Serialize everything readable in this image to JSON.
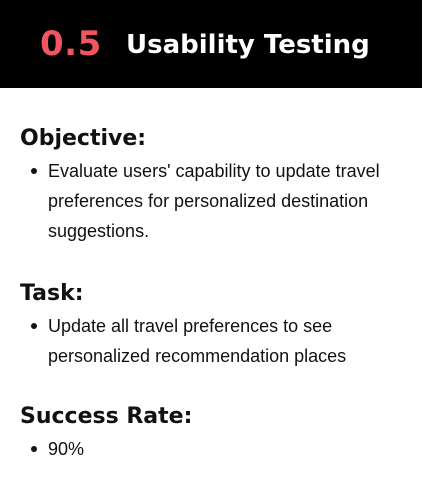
{
  "header": {
    "number": "0.5",
    "title": "Usability Testing"
  },
  "sections": {
    "objective": {
      "heading": "Objective:",
      "items": [
        "Evaluate users' capability to update travel preferences for personalized destination suggestions."
      ]
    },
    "task": {
      "heading": "Task:",
      "items": [
        "Update all travel preferences to see personalized recommendation places"
      ]
    },
    "success": {
      "heading": "Success Rate:",
      "items": [
        "90%"
      ]
    }
  },
  "colors": {
    "header_background": "#000000",
    "accent": "#f25562",
    "text": "#111111"
  }
}
